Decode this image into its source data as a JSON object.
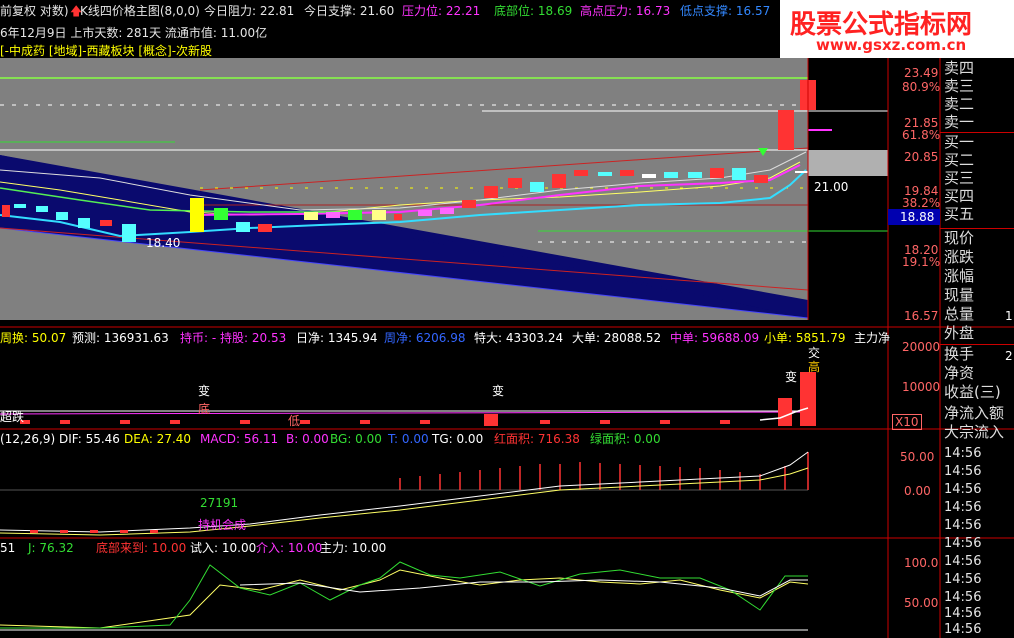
{
  "header": {
    "row1": [
      {
        "text": "前复权 对数)",
        "color": "#e6e6e6"
      },
      {
        "text": "K线四价格主图(8,0,0)",
        "color": "#e6e6e6"
      },
      {
        "text": "今日阻力: 22.81",
        "color": "#e6e6e6"
      },
      {
        "text": "今日支撑: 21.60",
        "color": "#e6e6e6"
      },
      {
        "text": "压力位: 22.21",
        "color": "#ff33ff"
      },
      {
        "text": "底部位: 18.69",
        "color": "#33dd33"
      },
      {
        "text": "高点压力: 16.73",
        "color": "#ff33ff"
      },
      {
        "text": "低点支撑: 16.57",
        "color": "#3388ff"
      }
    ],
    "row2": "6年12月9日  上市天数: 281天  流通市值: 11.00亿",
    "row3": "[-中成药 [地域]-西藏板块 [概念]-次新股"
  },
  "watermark": {
    "title": "股票公式指标网",
    "url": "www.gsxz.com.cn"
  },
  "price_axis": [
    "23.49",
    "80.9%",
    "21.85",
    "61.8%",
    "20.85",
    "19.84",
    "38.2%",
    "18.88",
    "18.20",
    "19.1%",
    "16.57"
  ],
  "price_notes": {
    "low": "18.40",
    "level": "21.00"
  },
  "volume_bar": {
    "items": [
      {
        "text": "周换: 50.07",
        "color": "#ffff00"
      },
      {
        "text": "预测: 136931.63",
        "color": "#ffffff"
      },
      {
        "text": "持币: - 持股: 20.53",
        "color": "#ff33ff"
      },
      {
        "text": "日净: 1345.94",
        "color": "#ffffff"
      },
      {
        "text": "周净: 6206.98",
        "color": "#3366ff"
      },
      {
        "text": "特大: 43303.24",
        "color": "#ffffff"
      },
      {
        "text": "大单: 28088.52",
        "color": "#ffffff"
      },
      {
        "text": "中单: 59688.09",
        "color": "#ff33ff"
      },
      {
        "text": "小单: 5851.79",
        "color": "#ffff00"
      },
      {
        "text": "主力净",
        "color": "#ffffff"
      }
    ],
    "marks": {
      "bian1": "变",
      "di": "底",
      "bian2": "变",
      "bian3": "变",
      "di2": "低",
      "chao": "超跌",
      "gao": "高",
      "jia": "交",
      "x10": "X10"
    }
  },
  "volume_axis": [
    "20000",
    "10000"
  ],
  "macd_bar": {
    "items": [
      {
        "text": "(12,26,9) DIF: 55.46",
        "color": "#ffffff"
      },
      {
        "text": "DEA: 27.40",
        "color": "#ffff00"
      },
      {
        "text": "MACD: 56.11",
        "color": "#ff33ff"
      },
      {
        "text": "B: 0.00",
        "color": "#ff33ff"
      },
      {
        "text": "BG: 0.00",
        "color": "#33dd33"
      },
      {
        "text": "T: 0.00",
        "color": "#3366ff"
      },
      {
        "text": "TG: 0.00",
        "color": "#ffffff"
      },
      {
        "text": "红面积: 716.38",
        "color": "#ff3333"
      },
      {
        "text": "绿面积: 0.00",
        "color": "#33dd33"
      }
    ],
    "value_label": "27191",
    "pink_label": "持机会成"
  },
  "macd_axis": [
    "50.00",
    "0.00"
  ],
  "kdj_bar": {
    "items": [
      {
        "text": "51",
        "color": "#ffffff"
      },
      {
        "text": "J: 76.32",
        "color": "#33dd33"
      },
      {
        "text": "底部来到: 10.00",
        "color": "#ff3333"
      },
      {
        "text": "试入: 10.00",
        "color": "#ffffff"
      },
      {
        "text": "介入: 10.00",
        "color": "#ff33ff"
      },
      {
        "text": "主力: 10.00",
        "color": "#ffffff"
      }
    ]
  },
  "kdj_axis": [
    "100.0",
    "50.00"
  ],
  "right_panel": {
    "orders": [
      "卖四",
      "卖三",
      "卖二",
      "卖一",
      "买一",
      "买二",
      "买三",
      "买四",
      "买五"
    ],
    "stats": [
      "现价",
      "涨跌",
      "涨幅",
      "现量",
      "总量",
      "外盘"
    ],
    "stats2": [
      "换手",
      "净资",
      "收益(三)",
      "净流入额",
      "大宗流入"
    ],
    "extra_1": "1",
    "extra_2": "2"
  },
  "times": [
    "14:56",
    "14:56",
    "14:56",
    "14:56",
    "14:56",
    "14:56",
    "14:56",
    "14:56",
    "14:56",
    "14:56",
    "14:56",
    "14:57"
  ]
}
